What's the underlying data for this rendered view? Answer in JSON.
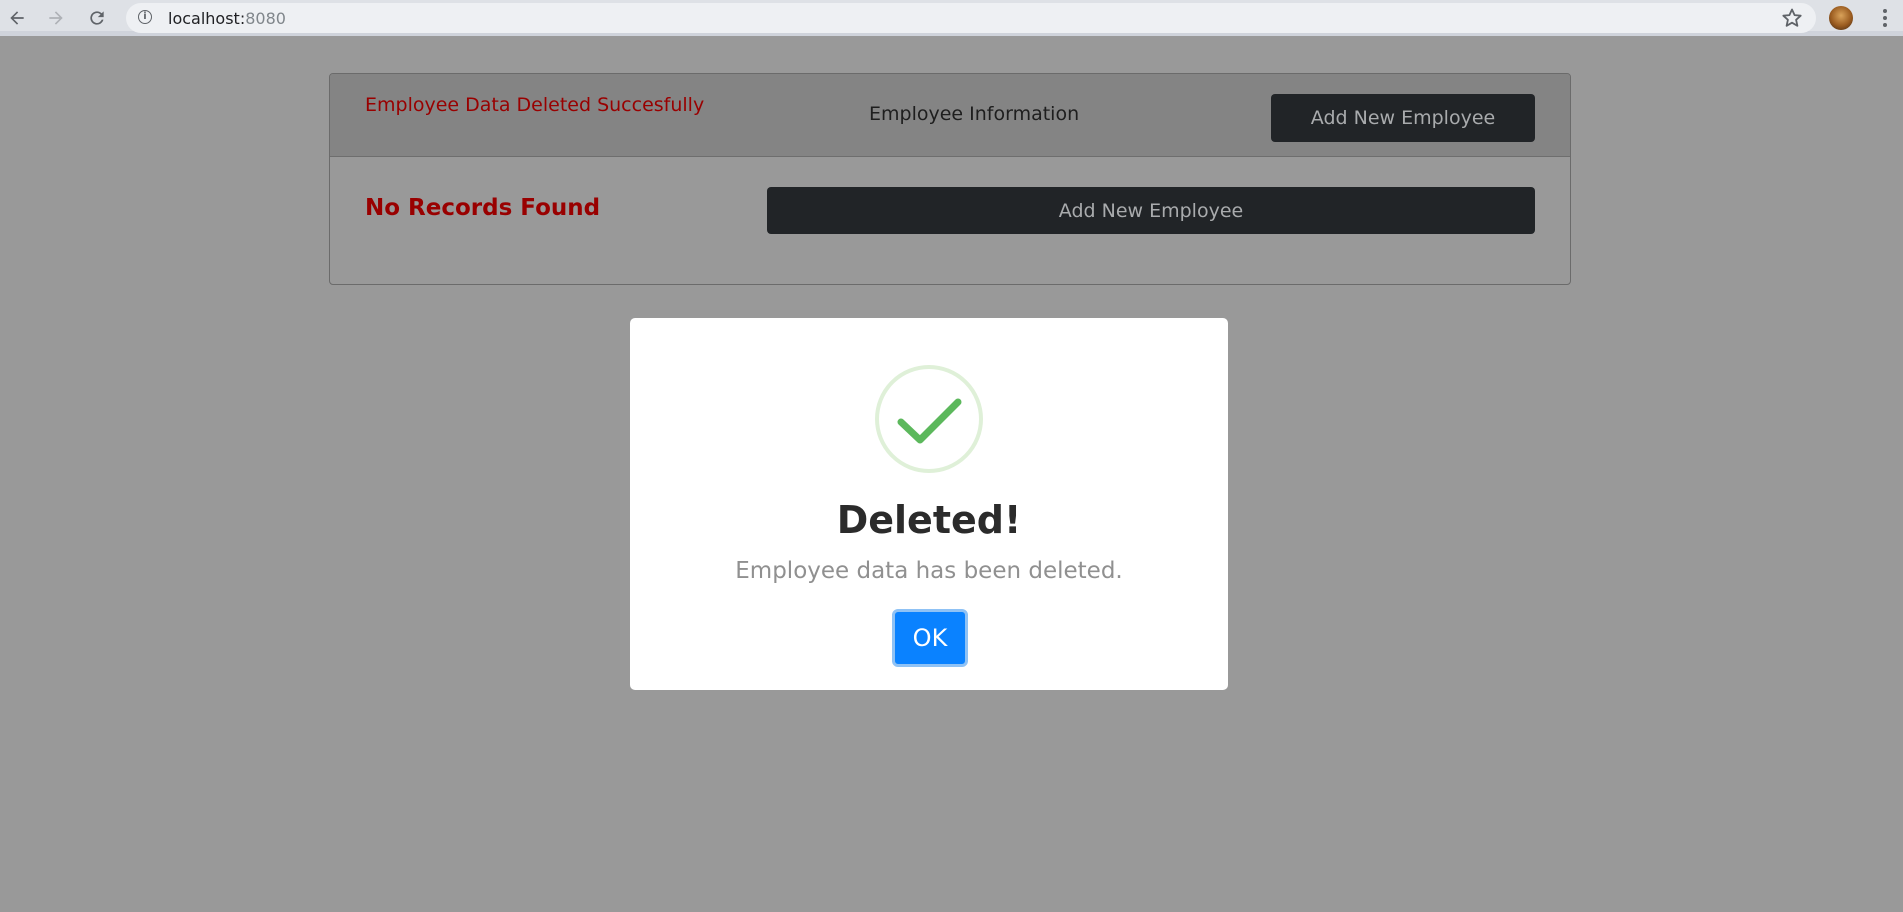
{
  "browser": {
    "url_host": "localhost:",
    "url_port": "8080",
    "back_icon": "arrow-left-icon",
    "forward_icon": "arrow-right-icon",
    "reload_icon": "reload-icon",
    "info_icon": "info-icon",
    "bookmark_icon": "star-icon",
    "menu_icon": "vertical-dots-icon"
  },
  "card": {
    "alert": "Employee Data Deleted Succesfully",
    "title": "Employee Information",
    "header_button": "Add New Employee",
    "empty_message": "No Records Found",
    "body_button": "Add New Employee"
  },
  "modal": {
    "icon": "checkmark-icon",
    "title": "Deleted!",
    "message": "Employee data has been deleted.",
    "ok_label": "OK"
  },
  "colors": {
    "overlay": "#999999",
    "alert_red": "#990000",
    "button_dark": "#212427",
    "ok_blue": "#0a82ff",
    "success_green": "#5cb85c"
  }
}
